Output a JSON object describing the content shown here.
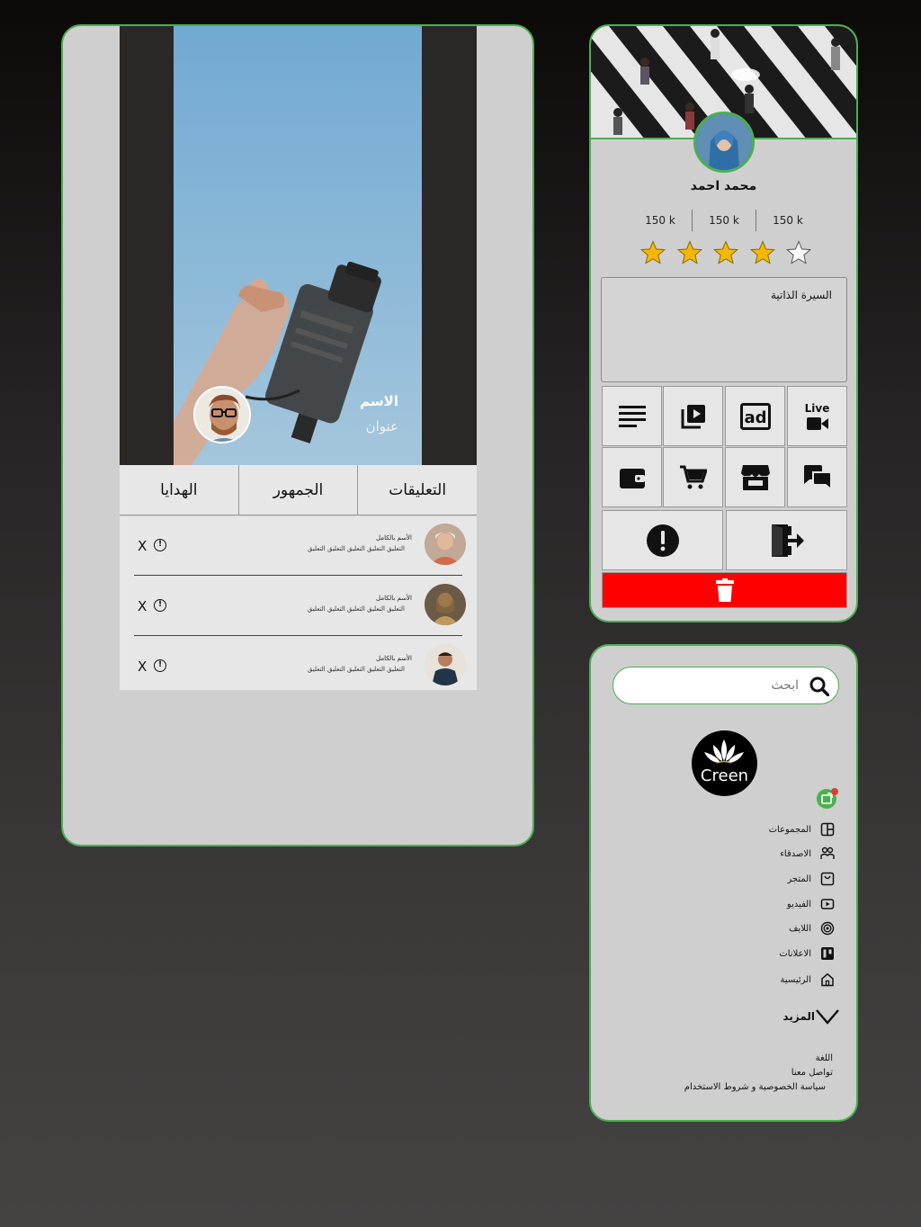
{
  "story": {
    "name": "الاسم",
    "subtitle": "عنوان",
    "tabs": [
      "التعليقات",
      "الجمهور",
      "الهدايا"
    ],
    "comments": [
      {
        "name": "الأسم بالكامل",
        "text": "التعليق التعليق التعليق التعليق التعليق",
        "close": "X",
        "report": "!"
      },
      {
        "name": "الأسم بالكامل",
        "text": "التعليق التعليق التعليق التعليق التعليق",
        "close": "X",
        "report": "!"
      },
      {
        "name": "الأسم بالكامل",
        "text": "التعليق التعليق التعليق التعليق التعليق",
        "close": "X",
        "report": "!"
      }
    ]
  },
  "profile": {
    "name": "محمد احمد",
    "stats": [
      "150 k",
      "150 k",
      "150 k"
    ],
    "rating": 4,
    "rating_max": 5,
    "bio_label": "السيرة الذاتية",
    "live_label": "Live",
    "buttons": {
      "row1": [
        "list-icon",
        "video-library-icon",
        "ad-icon",
        "live-video-icon"
      ],
      "row2": [
        "wallet-icon",
        "cart-icon",
        "store-icon",
        "chat-icon"
      ],
      "row3": [
        "report-icon",
        "logout-icon"
      ],
      "delete": "trash-icon"
    },
    "colors": {
      "accent": "#4caf50",
      "star": "#f5b800",
      "delete": "#ff0000"
    }
  },
  "menu": {
    "search_placeholder": "ابحث",
    "logo_text": "Creen",
    "nav": [
      {
        "label": "المجموعات",
        "icon": "groups-icon"
      },
      {
        "label": "الاصدقاء",
        "icon": "friends-icon"
      },
      {
        "label": "المتجر",
        "icon": "store-icon"
      },
      {
        "label": "الفيديو",
        "icon": "video-icon"
      },
      {
        "label": "اللايف",
        "icon": "live-icon"
      },
      {
        "label": "الاعلانات",
        "icon": "ads-icon"
      },
      {
        "label": "الرئيسية",
        "icon": "home-icon"
      }
    ],
    "more_label": "المزيد",
    "footer": [
      "اللغة",
      "تواصل معنا",
      "سياسة الخصوصية و شروط الاستخدام"
    ]
  }
}
